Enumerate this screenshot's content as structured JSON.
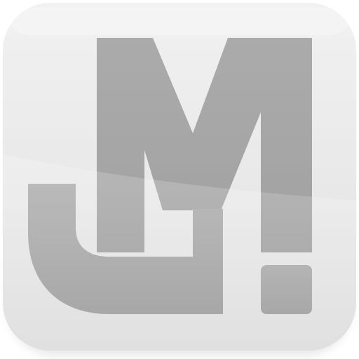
{
  "app_icon": {
    "icon": "jm-logo-icon",
    "logo_text": "JM",
    "colors": {
      "tile_light": "#efefef",
      "tile_mid": "#e6e6e6",
      "tile_dark": "#dcdcdc",
      "glyph_top": "#a9a9a9",
      "glyph_bottom": "#a0a0a0",
      "shadow": "#cfcfcf"
    }
  }
}
